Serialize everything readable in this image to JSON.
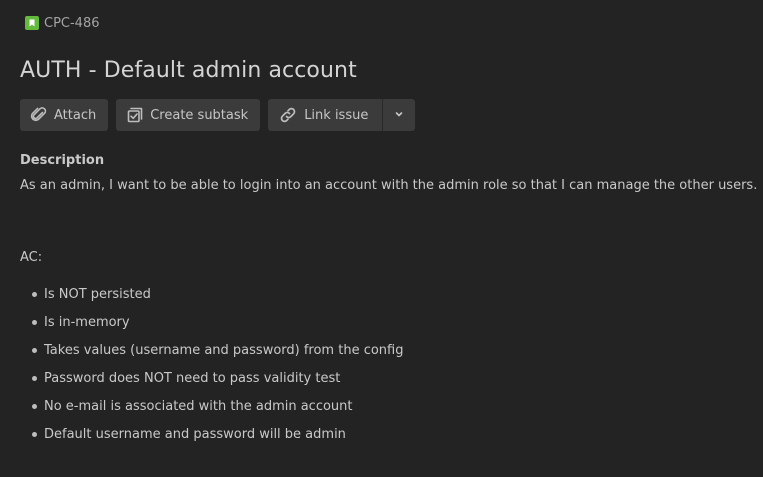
{
  "issue": {
    "key": "CPC-486",
    "type_icon": "story-bookmark-icon",
    "type_color": "#63ba3c",
    "title": "AUTH - Default admin account"
  },
  "toolbar": {
    "attach_label": "Attach",
    "attach_icon": "paperclip-icon",
    "subtask_label": "Create subtask",
    "subtask_icon": "subtask-checkbox-icon",
    "link_label": "Link issue",
    "link_icon": "link-icon",
    "more_icon": "chevron-down-icon"
  },
  "description": {
    "label": "Description",
    "text": "As an admin, I want to be able to login into an account with the admin role so that I can manage the other users.",
    "ac_label": "AC:",
    "ac_items": [
      "Is NOT persisted",
      "Is in-memory",
      "Takes values (username and password) from the config",
      "Password does NOT need to pass validity test",
      "No e-mail is associated with the admin account",
      "Default username and password will be admin"
    ]
  },
  "colors": {
    "background": "#232323",
    "button_bg": "#3b3b3b",
    "text": "#c9c9c9"
  }
}
